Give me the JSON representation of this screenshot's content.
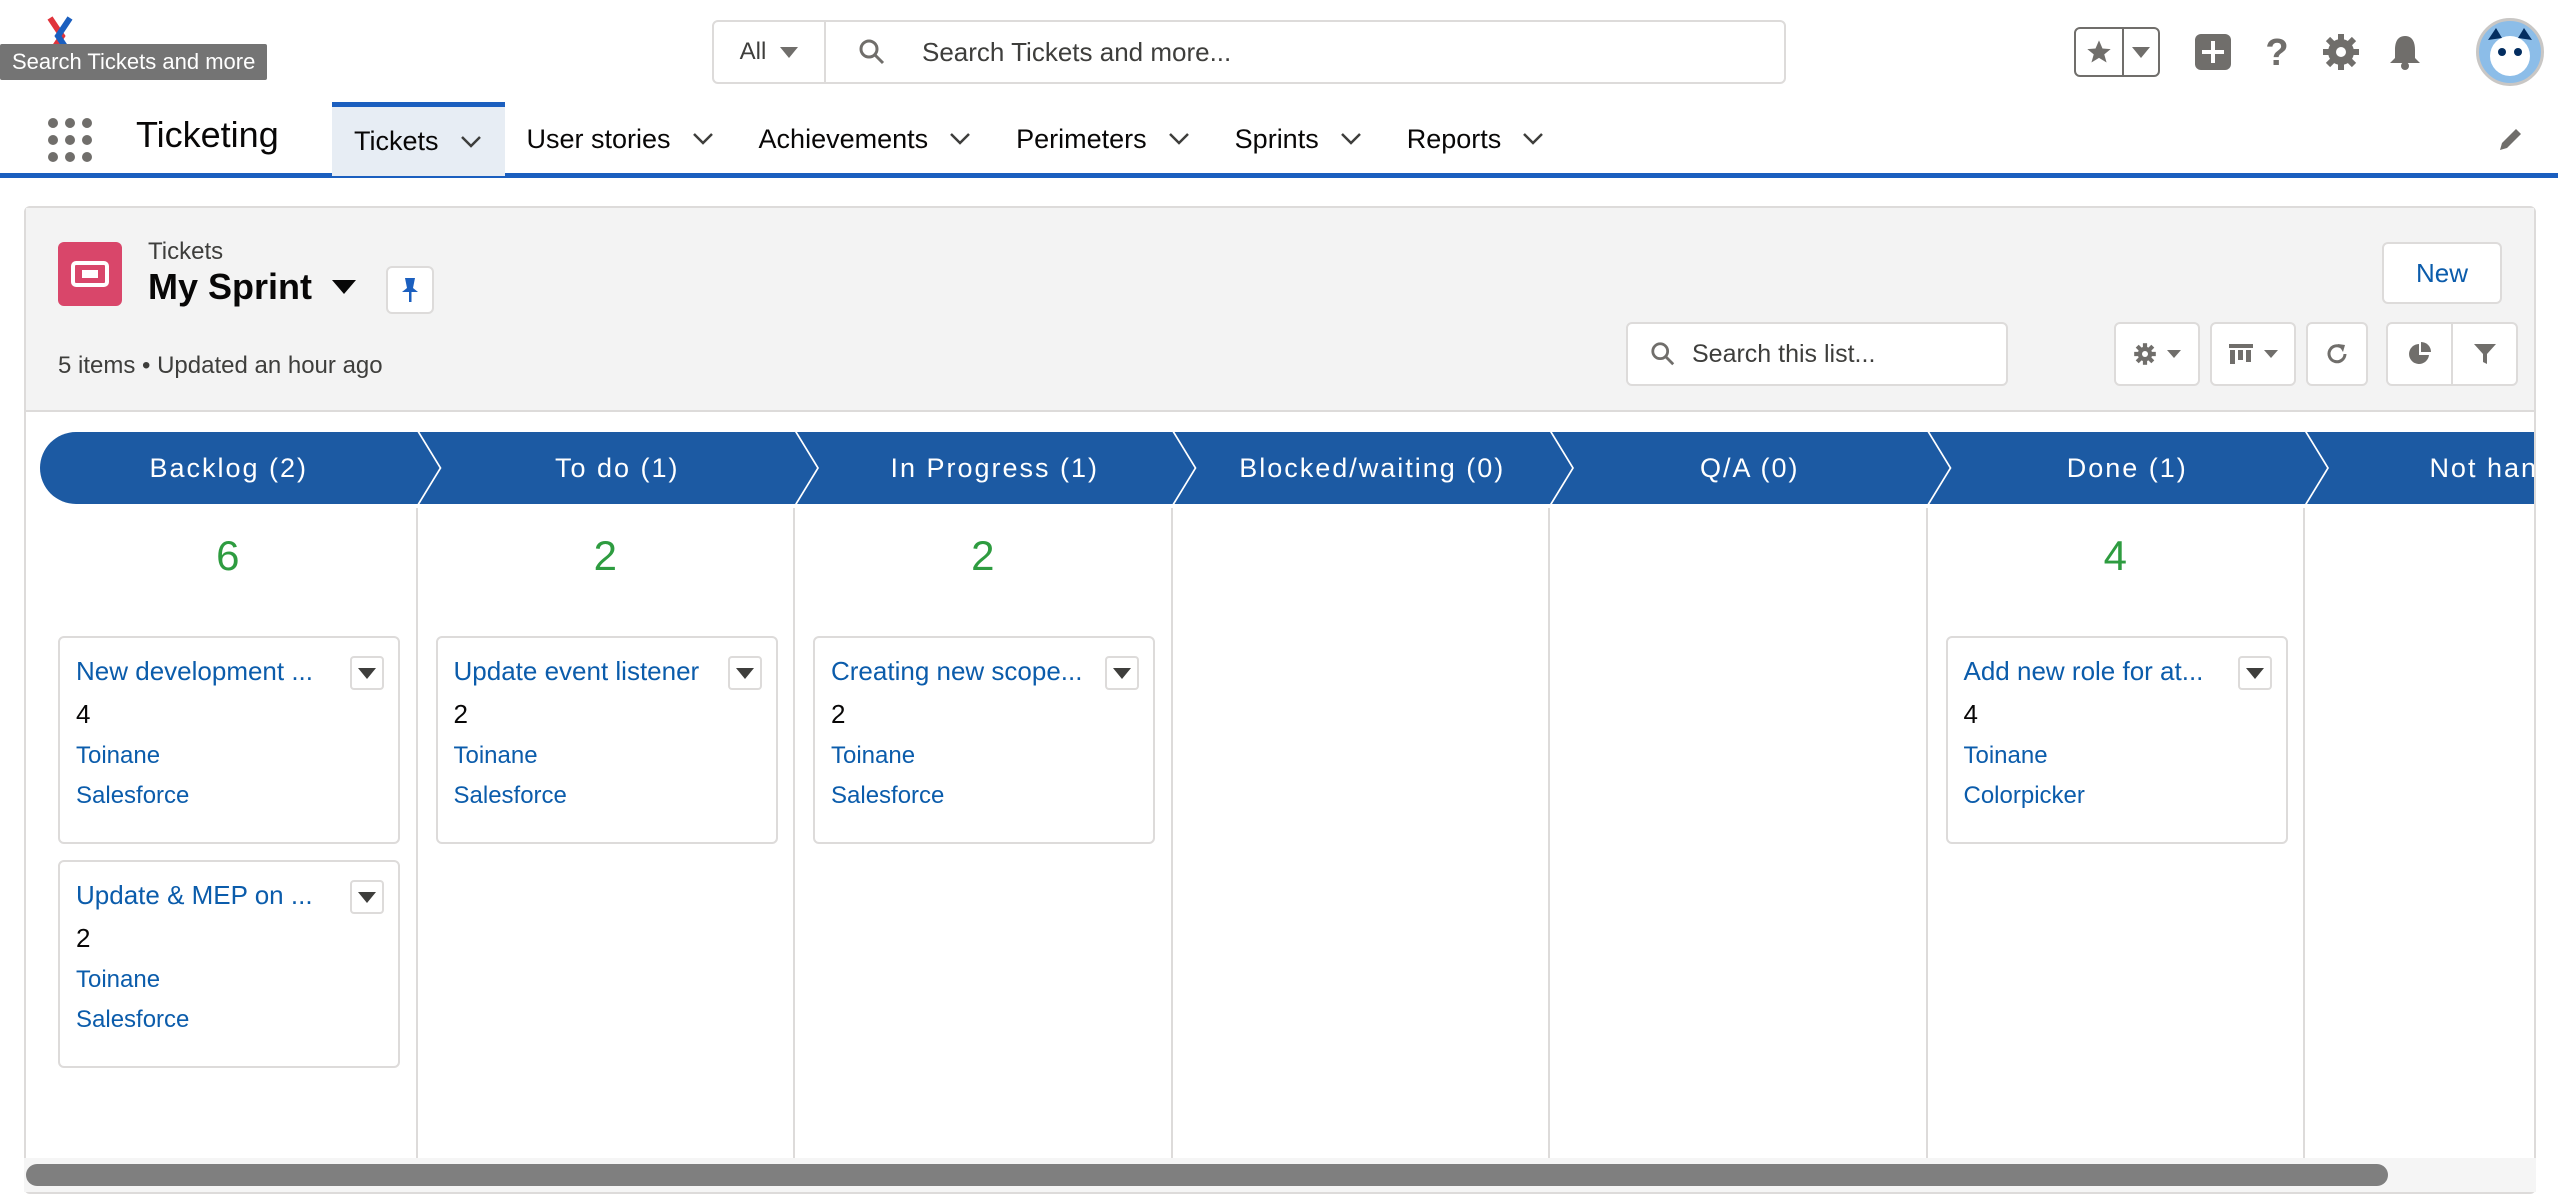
{
  "header": {
    "tooltip": "Search Tickets and more",
    "search_scope": "All",
    "search_placeholder": "Search Tickets and more..."
  },
  "app": {
    "name": "Ticketing",
    "tabs": [
      {
        "label": "Tickets",
        "active": true
      },
      {
        "label": "User stories"
      },
      {
        "label": "Achievements"
      },
      {
        "label": "Perimeters"
      },
      {
        "label": "Sprints"
      },
      {
        "label": "Reports"
      }
    ]
  },
  "list": {
    "object_label": "Tickets",
    "view_name": "My Sprint",
    "meta": "5 items • Updated an hour ago",
    "new_label": "New",
    "search_placeholder": "Search this list..."
  },
  "colors": {
    "accent": "#1b5fbf",
    "stage_bg": "#1c5aa3",
    "sum_green": "#2e9c40",
    "link": "#0b5cab",
    "object_icon": "#d9466a"
  },
  "stages": [
    {
      "label": "Backlog   (2)",
      "sum": "6",
      "cards": [
        {
          "title": "New development ...",
          "points": "4",
          "owner": "Toinane",
          "project": "Salesforce"
        },
        {
          "title": "Update & MEP on ...",
          "points": "2",
          "owner": "Toinane",
          "project": "Salesforce"
        }
      ]
    },
    {
      "label": "To do   (1)",
      "sum": "2",
      "cards": [
        {
          "title": "Update event listener",
          "points": "2",
          "owner": "Toinane",
          "project": "Salesforce"
        }
      ]
    },
    {
      "label": "In Progress   (1)",
      "sum": "2",
      "cards": [
        {
          "title": "Creating new scope...",
          "points": "2",
          "owner": "Toinane",
          "project": "Salesforce"
        }
      ]
    },
    {
      "label": "Blocked/waiting   (0)",
      "sum": "",
      "cards": []
    },
    {
      "label": "Q/A   (0)",
      "sum": "",
      "cards": []
    },
    {
      "label": "Done   (1)",
      "sum": "4",
      "cards": [
        {
          "title": "Add new role for at...",
          "points": "4",
          "owner": "Toinane",
          "project": "Colorpicker"
        }
      ]
    },
    {
      "label": "Not handle",
      "sum": "",
      "cards": []
    }
  ]
}
